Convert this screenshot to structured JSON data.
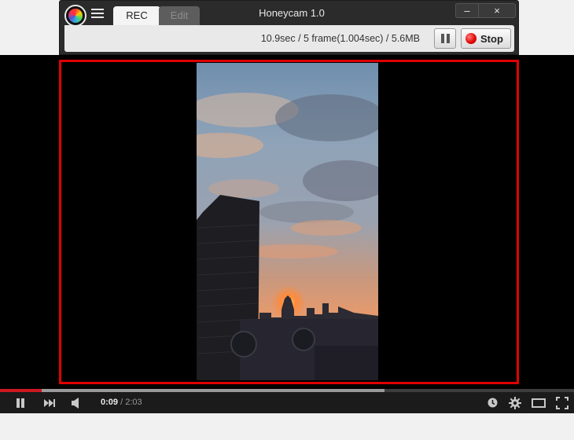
{
  "honeycam": {
    "tabs": [
      {
        "label": "REC",
        "active": true
      },
      {
        "label": "Edit",
        "active": false
      }
    ],
    "title": "Honeycam 1.0",
    "window_buttons": {
      "minimize": "–",
      "close": "×"
    },
    "status": "10.9sec / 5 frame(1.004sec) / 5.6MB",
    "stop_label": "Stop",
    "record_color": "#e00000"
  },
  "player": {
    "time_current": "0:09",
    "time_separator": " / ",
    "time_total": "2:03",
    "progress_played": 0.073,
    "progress_buffered": 0.67,
    "accent_color": "#cc181e",
    "icons": [
      "pause-icon",
      "next-icon",
      "volume-icon",
      "watch-later-icon",
      "settings-icon",
      "theater-mode-icon",
      "fullscreen-icon"
    ]
  }
}
